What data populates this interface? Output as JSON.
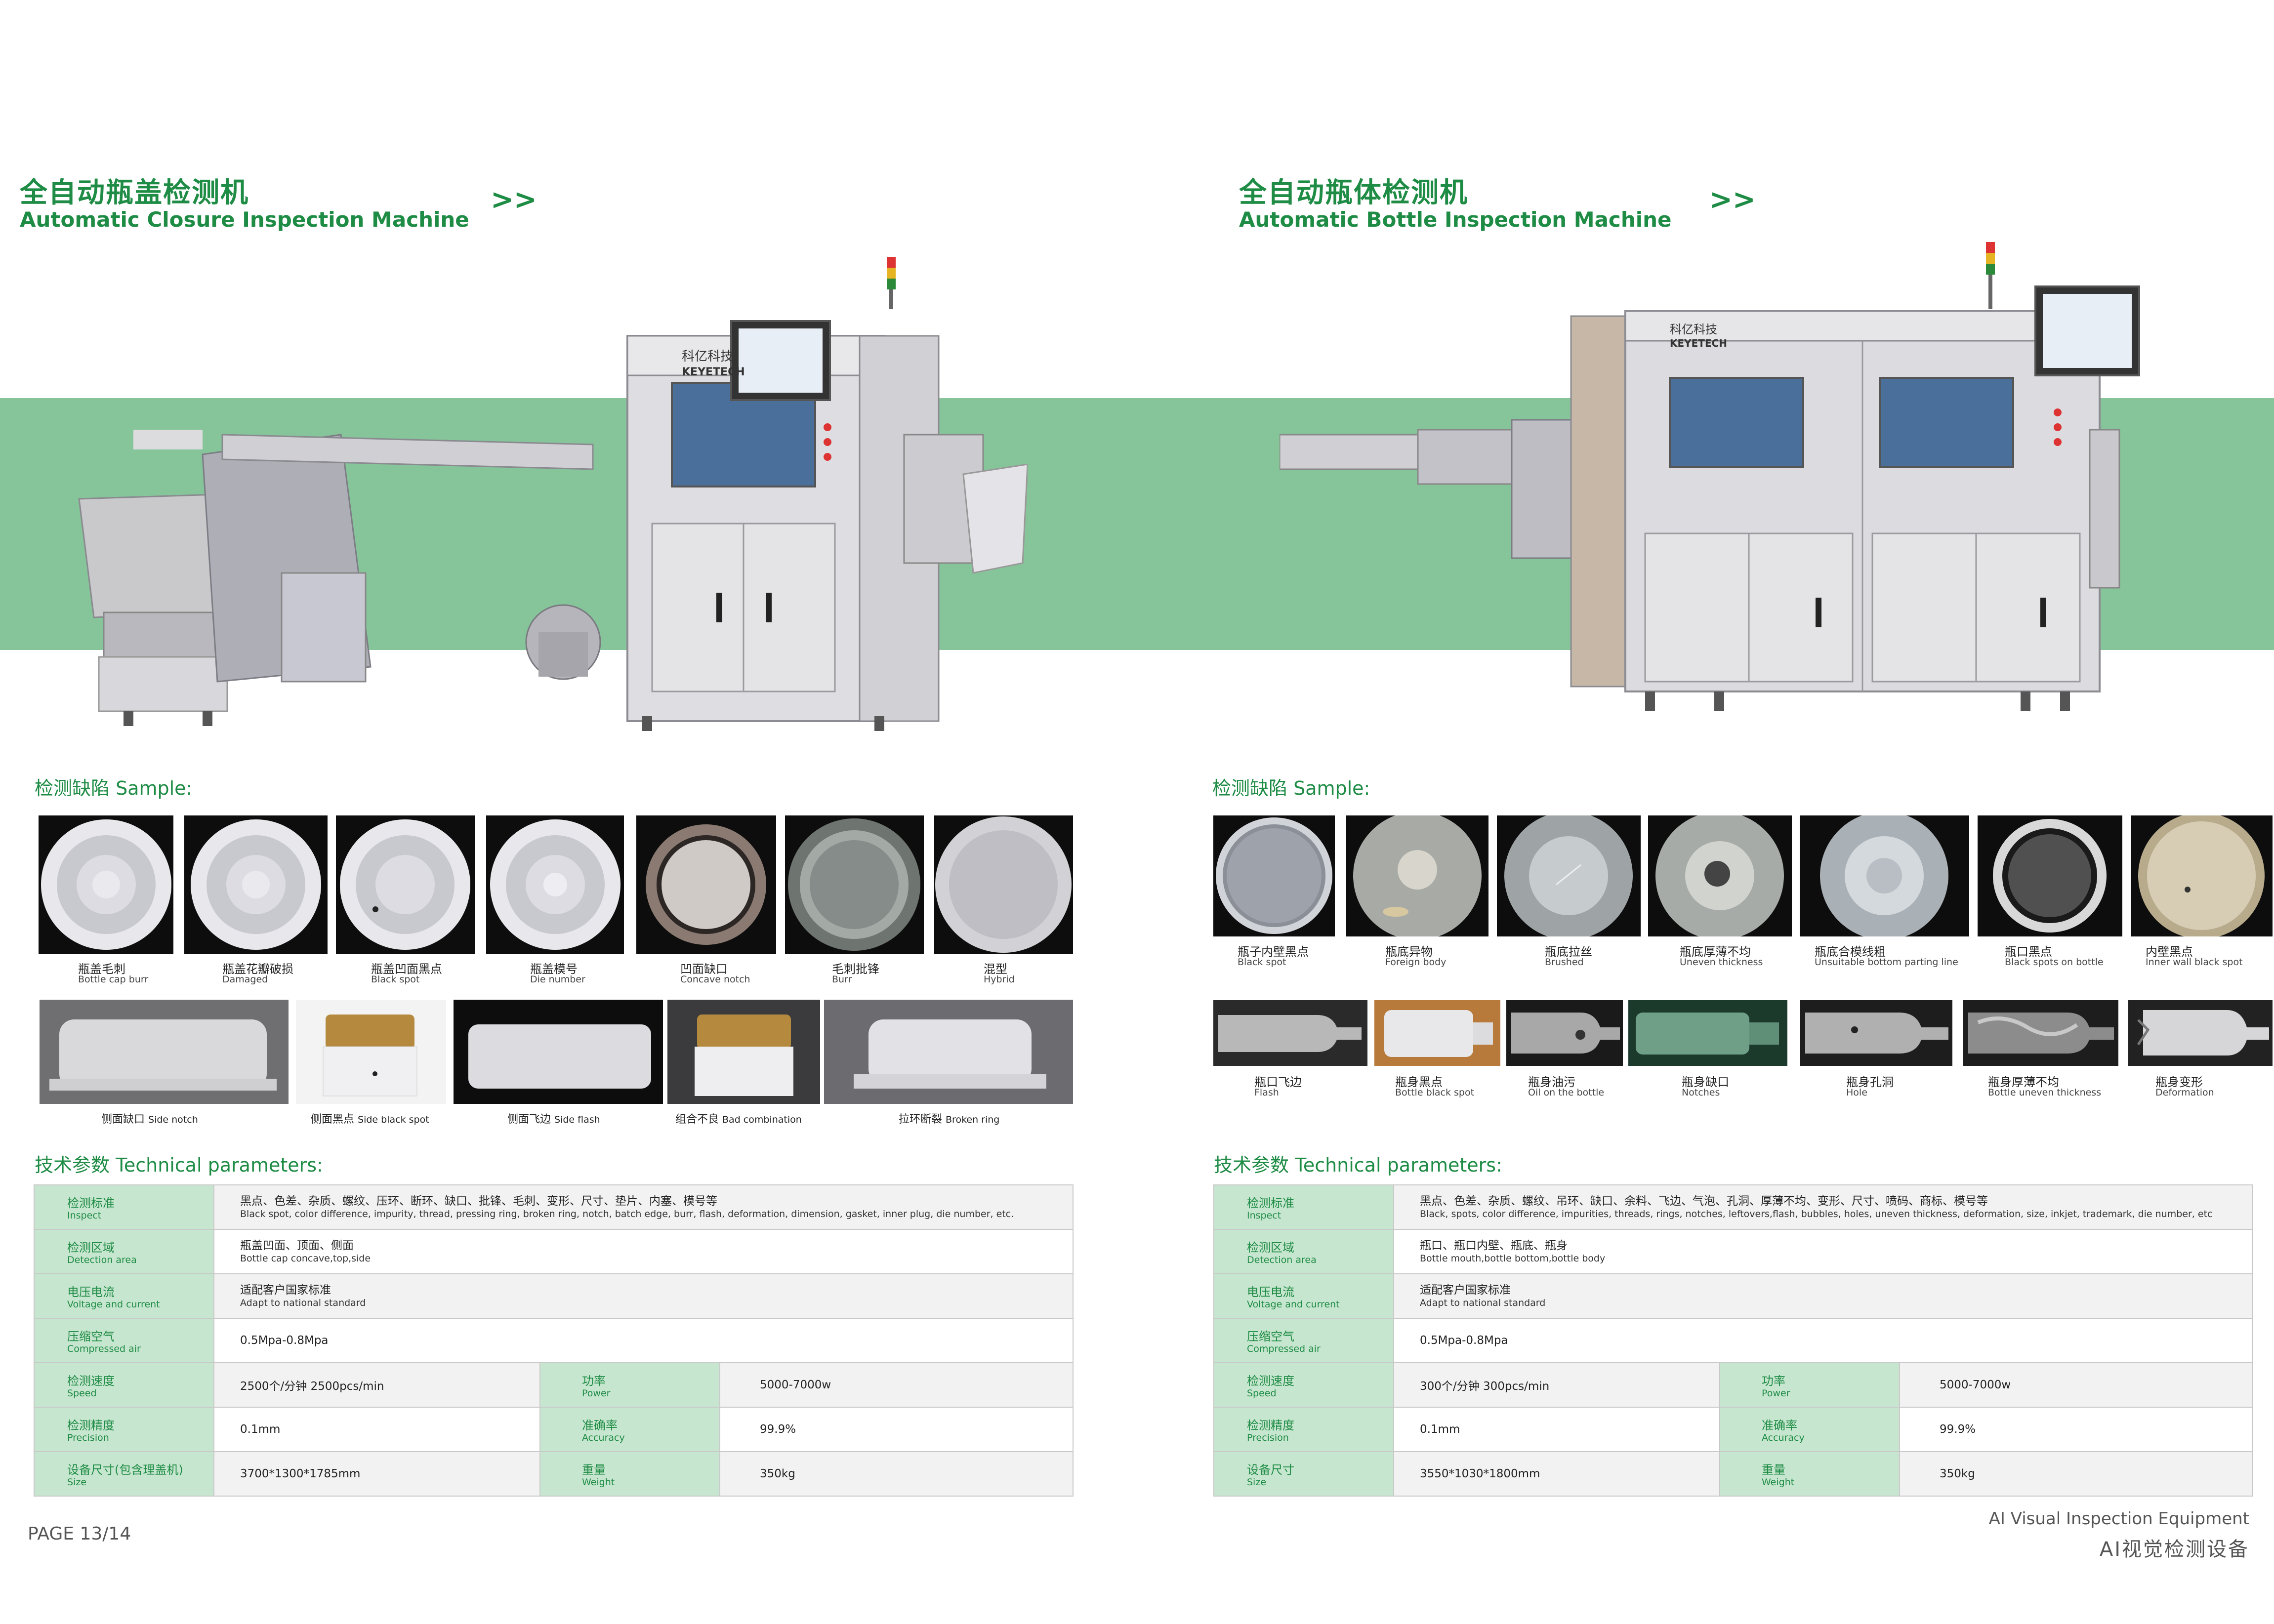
{
  "left": {
    "title_cn": "全自动瓶盖检测机",
    "title_en": "Automatic Closure Inspection Machine",
    "arrows": ">>",
    "machine_brand_cn": "科亿科技",
    "machine_brand_en": "KEYETECH",
    "samples_title": "检测缺陷 Sample:",
    "samples_row1": [
      {
        "cn": "瓶盖毛刺",
        "en": "Bottle cap burr"
      },
      {
        "cn": "瓶盖花瓣破损",
        "en": "Damaged"
      },
      {
        "cn": "瓶盖凹面黑点",
        "en": "Black spot"
      },
      {
        "cn": "瓶盖模号",
        "en": "Die number"
      },
      {
        "cn": "凹面缺口",
        "en": "Concave notch"
      },
      {
        "cn": "毛刺批锋",
        "en": "Burr"
      },
      {
        "cn": "混型",
        "en": "Hybrid"
      }
    ],
    "samples_row2": [
      {
        "cn": "侧面缺口",
        "en": "Side notch"
      },
      {
        "cn": "侧面黑点",
        "en": "Side black spot"
      },
      {
        "cn": "侧面飞边",
        "en": "Side flash"
      },
      {
        "cn": "组合不良",
        "en": "Bad combination"
      },
      {
        "cn": "拉环断裂",
        "en": "Broken ring"
      }
    ],
    "params_title": "技术参数 Technical parameters:",
    "params": {
      "inspect": {
        "k_cn": "检测标准",
        "k_en": "Inspect",
        "v_cn": "黑点、色差、杂质、螺纹、压环、断环、缺口、批锋、毛刺、变形、尺寸、垫片、内塞、模号等",
        "v_en": "Black spot, color difference, impurity, thread, pressing ring, broken ring, notch, batch edge, burr, flash, deformation, dimension, gasket, inner plug, die number, etc."
      },
      "area": {
        "k_cn": "检测区域",
        "k_en": "Detection area",
        "v_cn": "瓶盖凹面、顶面、侧面",
        "v_en": "Bottle cap concave,top,side"
      },
      "voltage": {
        "k_cn": "电压电流",
        "k_en": "Voltage and current",
        "v_cn": "适配客户国家标准",
        "v_en": "Adapt to national standard"
      },
      "air": {
        "k_cn": "压缩空气",
        "k_en": "Compressed air",
        "v": "0.5Mpa-0.8Mpa"
      },
      "speed": {
        "k_cn": "检测速度",
        "k_en": "Speed",
        "v": "2500个/分钟 2500pcs/min",
        "k2_cn": "功率",
        "k2_en": "Power",
        "v2": "5000-7000w"
      },
      "precision": {
        "k_cn": "检测精度",
        "k_en": "Precision",
        "v": "0.1mm",
        "k2_cn": "准确率",
        "k2_en": "Accuracy",
        "v2": "99.9%"
      },
      "size": {
        "k_cn": "设备尺寸(包含理盖机)",
        "k_en": "Size",
        "v": "3700*1300*1785mm",
        "k2_cn": "重量",
        "k2_en": "Weight",
        "v2": "350kg"
      }
    }
  },
  "right": {
    "title_cn": "全自动瓶体检测机",
    "title_en": "Automatic Bottle Inspection Machine",
    "arrows": ">>",
    "machine_brand_cn": "科亿科技",
    "machine_brand_en": "KEYETECH",
    "samples_title": "检测缺陷 Sample:",
    "samples_row1": [
      {
        "cn": "瓶子内壁黑点",
        "en": "Black spot"
      },
      {
        "cn": "瓶底异物",
        "en": "Foreign body"
      },
      {
        "cn": "瓶底拉丝",
        "en": "Brushed"
      },
      {
        "cn": "瓶底厚薄不均",
        "en": "Uneven thickness"
      },
      {
        "cn": "瓶底合模线粗",
        "en": "Unsuitable bottom parting line"
      },
      {
        "cn": "瓶口黑点",
        "en": "Black spots on bottle"
      },
      {
        "cn": "内壁黑点",
        "en": "Inner wall black spot"
      }
    ],
    "samples_row2": [
      {
        "cn": "瓶口飞边",
        "en": "Flash"
      },
      {
        "cn": "瓶身黑点",
        "en": "Bottle black spot"
      },
      {
        "cn": "瓶身油污",
        "en": "Oil on the bottle"
      },
      {
        "cn": "瓶身缺口",
        "en": "Notches"
      },
      {
        "cn": "瓶身孔洞",
        "en": "Hole"
      },
      {
        "cn": "瓶身厚薄不均",
        "en": "Bottle uneven thickness"
      },
      {
        "cn": "瓶身变形",
        "en": "Deformation"
      }
    ],
    "params_title": "技术参数 Technical parameters:",
    "params": {
      "inspect": {
        "k_cn": "检测标准",
        "k_en": "Inspect",
        "v_cn": "黑点、色差、杂质、螺纹、吊环、缺口、余料、飞边、气泡、孔洞、厚薄不均、变形、尺寸、喷码、商标、模号等",
        "v_en": "Black, spots, color difference, impurities, threads, rings, notches, leftovers,flash, bubbles, holes, uneven thickness, deformation, size, inkjet, trademark, die number, etc"
      },
      "area": {
        "k_cn": "检测区域",
        "k_en": "Detection area",
        "v_cn": "瓶口、瓶口内壁、瓶底、瓶身",
        "v_en": "Bottle mouth,bottle bottom,bottle body"
      },
      "voltage": {
        "k_cn": "电压电流",
        "k_en": "Voltage and current",
        "v_cn": "适配客户国家标准",
        "v_en": "Adapt to national standard"
      },
      "air": {
        "k_cn": "压缩空气",
        "k_en": "Compressed air",
        "v": "0.5Mpa-0.8Mpa"
      },
      "speed": {
        "k_cn": "检测速度",
        "k_en": "Speed",
        "v": "300个/分钟 300pcs/min",
        "k2_cn": "功率",
        "k2_en": "Power",
        "v2": "5000-7000w"
      },
      "precision": {
        "k_cn": "检测精度",
        "k_en": "Precision",
        "v": "0.1mm",
        "k2_cn": "准确率",
        "k2_en": "Accuracy",
        "v2": "99.9%"
      },
      "size": {
        "k_cn": "设备尺寸",
        "k_en": "Size",
        "v": "3550*1030*1800mm",
        "k2_cn": "重量",
        "k2_en": "Weight",
        "v2": "350kg"
      }
    }
  },
  "footer": {
    "page": "PAGE 13/14",
    "tagline_en": "AI Visual Inspection Equipment",
    "tagline_cn": "AI视觉检测设备"
  },
  "colors": {
    "accent": "#1e8c45",
    "band": "#86c49a",
    "key_cell": "#c7e6cf"
  }
}
